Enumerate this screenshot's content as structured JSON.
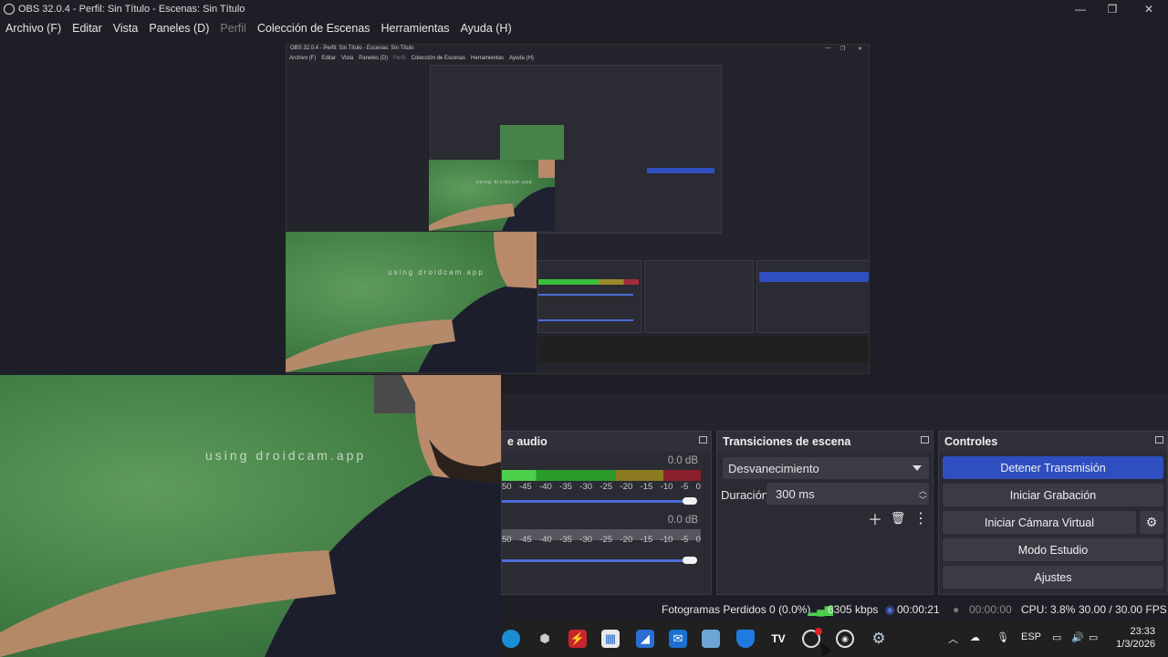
{
  "window": {
    "title": "OBS 32.0.4 - Perfil: Sin Título - Escenas: Sin Título",
    "controls": [
      "—",
      "❐",
      "✕"
    ]
  },
  "menu": [
    {
      "label": "Archivo (F)",
      "disabled": false
    },
    {
      "label": "Editar",
      "disabled": false
    },
    {
      "label": "Vista",
      "disabled": false
    },
    {
      "label": "Paneles (D)",
      "disabled": false
    },
    {
      "label": "Perfil",
      "disabled": true
    },
    {
      "label": "Colección de Escenas",
      "disabled": false
    },
    {
      "label": "Herramientas",
      "disabled": false
    },
    {
      "label": "Ayuda (H)",
      "disabled": false
    }
  ],
  "preview": {
    "watermark": "using droidcam.app",
    "nested_title": "OBS 32.0.4 - Perfil: Sin Título - Escenas: Sin Título",
    "nested_menu": [
      "Archivo (F)",
      "Editar",
      "Vista",
      "Paneles (D)",
      "Perfil",
      "Colección de Escenas",
      "Herramientas",
      "Ayuda (H)"
    ]
  },
  "audio": {
    "header": "e audio",
    "channels": [
      {
        "db": "0.0 dB"
      },
      {
        "db": "0.0 dB"
      }
    ],
    "scale": [
      "50",
      "-45",
      "-40",
      "-35",
      "-30",
      "-25",
      "-20",
      "-15",
      "-10",
      "-5",
      "0"
    ]
  },
  "transitions": {
    "header": "Transiciones de escena",
    "selected": "Desvanecimiento",
    "duration_label": "Duración",
    "duration_value": "300 ms"
  },
  "controls": {
    "header": "Controles",
    "buttons": [
      "Detener Transmisión",
      "Iniciar Grabación",
      "Iniciar Cámara Virtual",
      "Modo Estudio",
      "Ajustes"
    ]
  },
  "status": {
    "dropped": "Fotogramas Perdidos 0 (0.0%)",
    "bitrate": "6305 kbps",
    "stream_time": "00:00:21",
    "rec_time": "00:00:00",
    "cpu": "CPU: 3.8%",
    "fps": "30.00 / 30.00 FPS"
  },
  "taskbar": {
    "language": "ESP",
    "time": "23:33",
    "date": "1/3/2026"
  },
  "colors": {
    "accent": "#2f4fc0",
    "background": "#1e1f26",
    "panel": "#2a2b33"
  }
}
